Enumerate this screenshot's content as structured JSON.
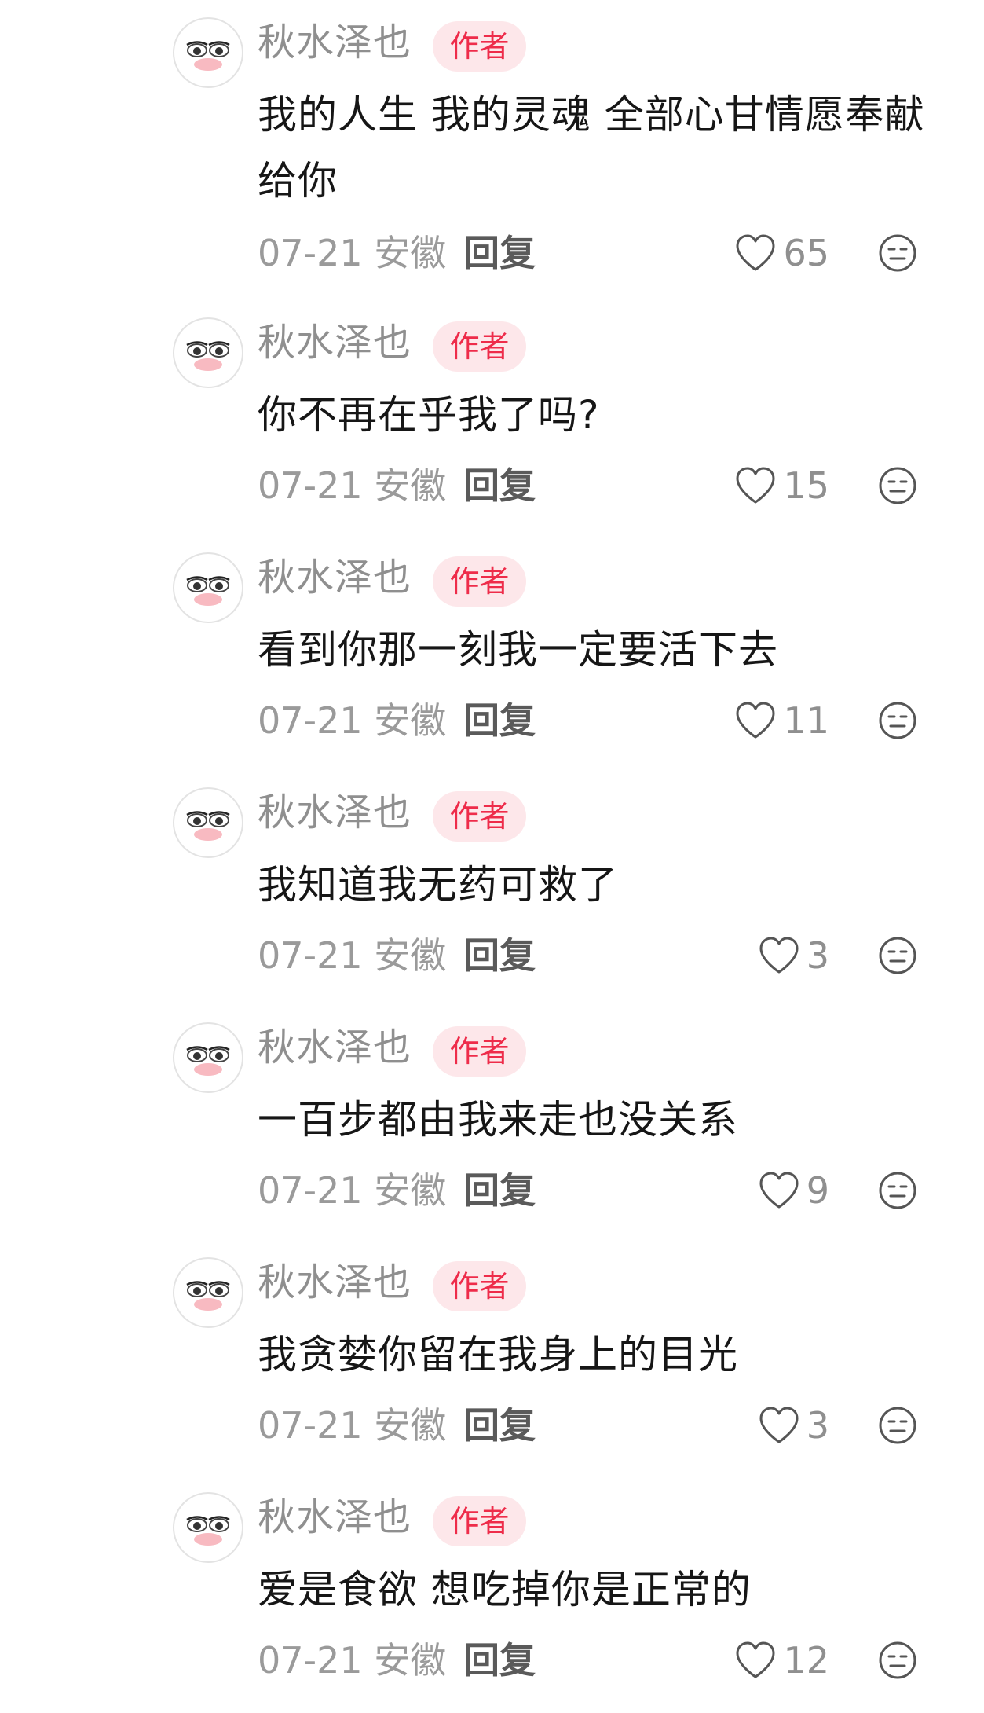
{
  "comments": [
    {
      "username": "秋水泽也",
      "badge": "作者",
      "text": "我的人生 我的灵魂 全部心甘情愿奉献给你",
      "date": "07-21",
      "location": "安徽",
      "reply_label": "回复",
      "likes": "65",
      "icons": {
        "avatar": "avatar-icon",
        "like": "heart-icon",
        "dislike": "neutral-face-icon"
      }
    },
    {
      "username": "秋水泽也",
      "badge": "作者",
      "text": "你不再在乎我了吗?",
      "date": "07-21",
      "location": "安徽",
      "reply_label": "回复",
      "likes": "15",
      "icons": {
        "avatar": "avatar-icon",
        "like": "heart-icon",
        "dislike": "neutral-face-icon"
      }
    },
    {
      "username": "秋水泽也",
      "badge": "作者",
      "text": "看到你那一刻我一定要活下去",
      "date": "07-21",
      "location": "安徽",
      "reply_label": "回复",
      "likes": "11",
      "icons": {
        "avatar": "avatar-icon",
        "like": "heart-icon",
        "dislike": "neutral-face-icon"
      }
    },
    {
      "username": "秋水泽也",
      "badge": "作者",
      "text": "我知道我无药可救了",
      "date": "07-21",
      "location": "安徽",
      "reply_label": "回复",
      "likes": "3",
      "icons": {
        "avatar": "avatar-icon",
        "like": "heart-icon",
        "dislike": "neutral-face-icon"
      }
    },
    {
      "username": "秋水泽也",
      "badge": "作者",
      "text": "一百步都由我来走也没关系",
      "date": "07-21",
      "location": "安徽",
      "reply_label": "回复",
      "likes": "9",
      "icons": {
        "avatar": "avatar-icon",
        "like": "heart-icon",
        "dislike": "neutral-face-icon"
      }
    },
    {
      "username": "秋水泽也",
      "badge": "作者",
      "text": "我贪婪你留在我身上的目光",
      "date": "07-21",
      "location": "安徽",
      "reply_label": "回复",
      "likes": "3",
      "icons": {
        "avatar": "avatar-icon",
        "like": "heart-icon",
        "dislike": "neutral-face-icon"
      }
    },
    {
      "username": "秋水泽也",
      "badge": "作者",
      "text": "爱是食欲 想吃掉你是正常的",
      "date": "07-21",
      "location": "安徽",
      "reply_label": "回复",
      "likes": "12",
      "icons": {
        "avatar": "avatar-icon",
        "like": "heart-icon",
        "dislike": "neutral-face-icon"
      }
    }
  ],
  "colors": {
    "badge_text": "#ee2c4a",
    "badge_bg": "#fde7ea",
    "username": "#8f8f8f",
    "body_text": "#161616",
    "meta_text": "#9a9a9a"
  }
}
